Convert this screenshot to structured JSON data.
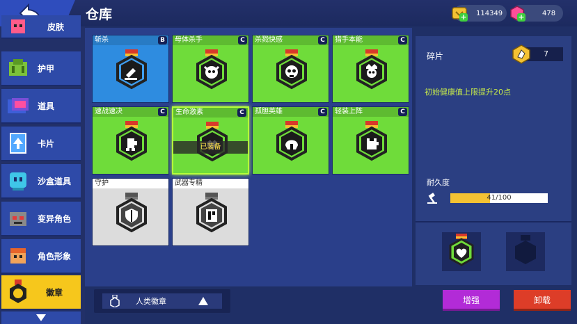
{
  "header": {
    "title": "仓库"
  },
  "currency": [
    {
      "name": "gold-coin",
      "value": "114349"
    },
    {
      "name": "pink-gem",
      "value": "478"
    }
  ],
  "sidebar": {
    "items": [
      {
        "label": "皮肤",
        "icon": "skin-icon"
      },
      {
        "label": "护甲",
        "icon": "armor-icon"
      },
      {
        "label": "道具",
        "icon": "item-icon"
      },
      {
        "label": "卡片",
        "icon": "card-icon"
      },
      {
        "label": "沙盒道具",
        "icon": "sandbox-icon"
      },
      {
        "label": "变异角色",
        "icon": "mutant-icon"
      },
      {
        "label": "角色形象",
        "icon": "avatar-icon"
      },
      {
        "label": "徽章",
        "icon": "badge-icon",
        "active": true
      }
    ]
  },
  "badges": [
    {
      "title": "斩杀",
      "grade": "B",
      "color": "blue",
      "icon": "blade"
    },
    {
      "title": "母体杀手",
      "grade": "C",
      "color": "green",
      "icon": "demon"
    },
    {
      "title": "杀戮快感",
      "grade": "C",
      "color": "green",
      "icon": "skull"
    },
    {
      "title": "猎手本能",
      "grade": "C",
      "color": "green",
      "icon": "crown-skull"
    },
    {
      "title": "速战速决",
      "grade": "C",
      "color": "green",
      "icon": "runner"
    },
    {
      "title": "生命激素",
      "grade": "C",
      "color": "green",
      "icon": "heart",
      "equipped": true,
      "equipped_label": "已装备"
    },
    {
      "title": "孤胆英雄",
      "grade": "C",
      "color": "green",
      "icon": "helmet"
    },
    {
      "title": "轻装上阵",
      "grade": "C",
      "color": "green",
      "icon": "vest"
    },
    {
      "title": "守护",
      "grade": "",
      "color": "gray",
      "icon": "shield"
    },
    {
      "title": "武器专精",
      "grade": "",
      "color": "gray",
      "icon": "book"
    }
  ],
  "filter": {
    "label": "人类徽章"
  },
  "detail": {
    "fragment_label": "碎片",
    "fragment_count": "7",
    "description": "初始健康值上限提升20点",
    "durability_label": "耐久度",
    "durability_text": "41/100",
    "durability_fraction": 0.41
  },
  "buttons": {
    "enhance": "增强",
    "unload": "卸载"
  },
  "colors": {
    "green_card": "#6fdc3a",
    "blue_card": "#2e8ce0",
    "gray_card": "#dcdcdc",
    "accent_yellow": "#f6c71c"
  }
}
